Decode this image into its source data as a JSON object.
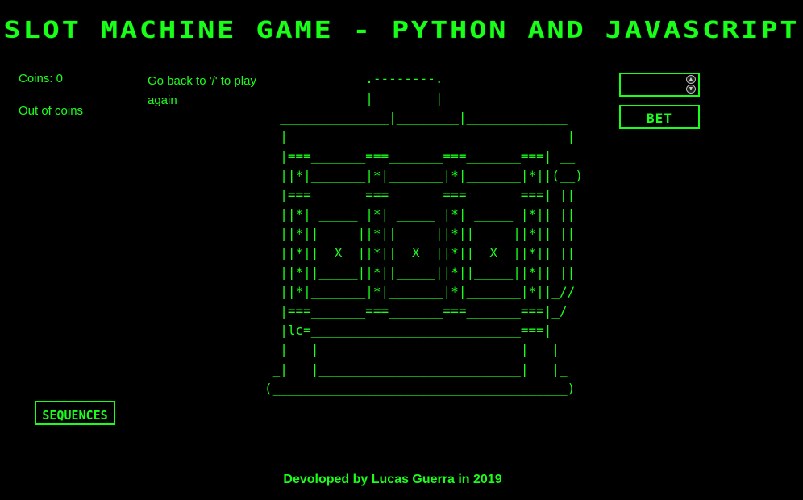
{
  "title": "Slot machine game - Python and Javascript",
  "status": {
    "coins_label": "Coins: 0",
    "out_of_coins": "Out of coins",
    "go_back": "Go back to '/' to play again"
  },
  "machine_art": "             .--------.\n             |        |\n  ______________|________|_____________\n  |                                    |\n  |===_______===_______===_______===| __\n  ||*|_______|*|_______|*|_______|*||(__)\n  |===_______===_______===_______===| ||\n  ||*| _____ |*| _____ |*| _____ |*|| ||\n  ||*||     ||*||     ||*||     ||*|| ||\n  ||*||  X  ||*||  X  ||*||  X  ||*|| ||\n  ||*||_____||*||_____||*||_____||*|| ||\n  ||*|_______|*|_______|*|_______|*||_//\n  |===_______===_______===_______===|_/\n  |lc=___________________________===|\n  |   |                          |   |\n _|   |__________________________|   |_\n(______________________________________)",
  "bet": {
    "input_value": "",
    "button_label": "Bet"
  },
  "sequences": {
    "button_label": "Sequences"
  },
  "footer": "Devoloped by Lucas Guerra in 2019",
  "colors": {
    "background": "#000000",
    "accent": "#1aff1a"
  }
}
